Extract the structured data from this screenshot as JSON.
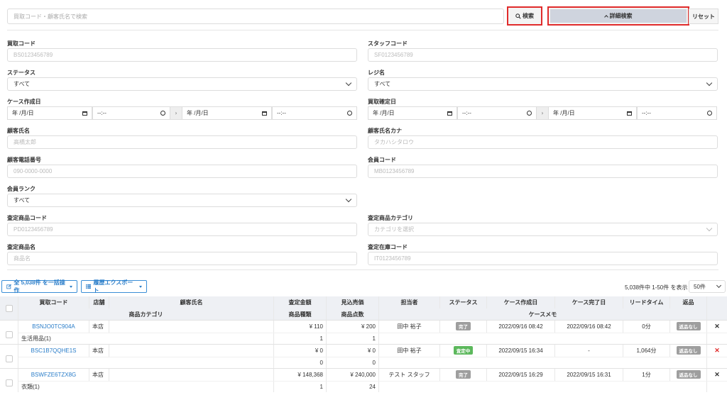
{
  "search": {
    "placeholder": "買取コード・顧客氏名で検索",
    "search_label": "検索",
    "detail_label": "詳細検索",
    "reset_label": "リセット"
  },
  "form": {
    "purchase_code": {
      "label": "買取コード",
      "placeholder": "BS0123456789"
    },
    "staff_code": {
      "label": "スタッフコード",
      "placeholder": "SF0123456789"
    },
    "status": {
      "label": "ステータス",
      "value": "すべて"
    },
    "register": {
      "label": "レジ名",
      "value": "すべて"
    },
    "case_created": {
      "label": "ケース作成日",
      "date": "年 /月/日",
      "time": "--:--"
    },
    "purchase_confirmed": {
      "label": "買取確定日",
      "date": "年 /月/日",
      "time": "--:--"
    },
    "customer_name": {
      "label": "顧客氏名",
      "placeholder": "高橋太郎"
    },
    "customer_kana": {
      "label": "顧客氏名カナ",
      "placeholder": "タカハシタロウ"
    },
    "customer_phone": {
      "label": "顧客電話番号",
      "placeholder": "090-0000-0000"
    },
    "member_code": {
      "label": "会員コード",
      "placeholder": "MB0123456789"
    },
    "member_rank": {
      "label": "会員ランク",
      "value": "すべて"
    },
    "item_code": {
      "label": "査定商品コード",
      "placeholder": "PD0123456789"
    },
    "item_category": {
      "label": "査定商品カテゴリ",
      "placeholder": "カテゴリを選択"
    },
    "item_name": {
      "label": "査定商品名",
      "placeholder": "商品名"
    },
    "stock_code": {
      "label": "査定在庫コード",
      "placeholder": "IT0123456789"
    }
  },
  "toolbar": {
    "bulk_label": "全 5,038件 を一括操作",
    "export_label": "履歴エクスポート",
    "count_text": "5,038件中 1-50件 を表示",
    "per_page": "50件"
  },
  "table": {
    "headers1": [
      "買取コード",
      "店舗",
      "顧客氏名",
      "査定金額",
      "見込売価",
      "担当者",
      "ステータス",
      "ケース作成日",
      "ケース完了日",
      "リードタイム",
      "返品"
    ],
    "headers2": [
      "商品カテゴリ",
      "商品種類",
      "商品点数",
      "ケースメモ"
    ],
    "rows": [
      {
        "code": "BSNJO0TC904A",
        "store": "本店",
        "name": "",
        "amount": "¥ 110",
        "price": "¥ 200",
        "staff": "田中 裕子",
        "status": "完了",
        "status_color": "#9e9e9e",
        "created": "2022/09/16 08:42",
        "completed": "2022/09/16 08:42",
        "lead": "0分",
        "return": "返品なし",
        "category": "生活用品(1)",
        "kinds": "1",
        "points": "1",
        "memo": "",
        "x_color": "#333333"
      },
      {
        "code": "BSC1B7QQHE1S",
        "store": "本店",
        "name": "",
        "amount": "¥ 0",
        "price": "¥ 0",
        "staff": "田中 裕子",
        "status": "査定中",
        "status_color": "#5cb85c",
        "created": "2022/09/15 16:34",
        "completed": "-",
        "lead": "1,064分",
        "return": "返品なし",
        "category": "",
        "kinds": "0",
        "points": "0",
        "memo": "",
        "x_color": "#e02b2b"
      },
      {
        "code": "BSWFZE6TZX8G",
        "store": "本店",
        "name": "",
        "amount": "¥ 148,368",
        "price": "¥ 240,000",
        "staff": "テスト スタッフ",
        "status": "完了",
        "status_color": "#9e9e9e",
        "created": "2022/09/15 16:29",
        "completed": "2022/09/15 16:31",
        "lead": "1分",
        "return": "返品なし",
        "category": "衣類(1)",
        "kinds": "1",
        "points": "24",
        "memo": "",
        "x_color": "#333333"
      }
    ]
  },
  "colors": {
    "accent": "#2a7dc9",
    "highlight": "#e02b2b"
  }
}
